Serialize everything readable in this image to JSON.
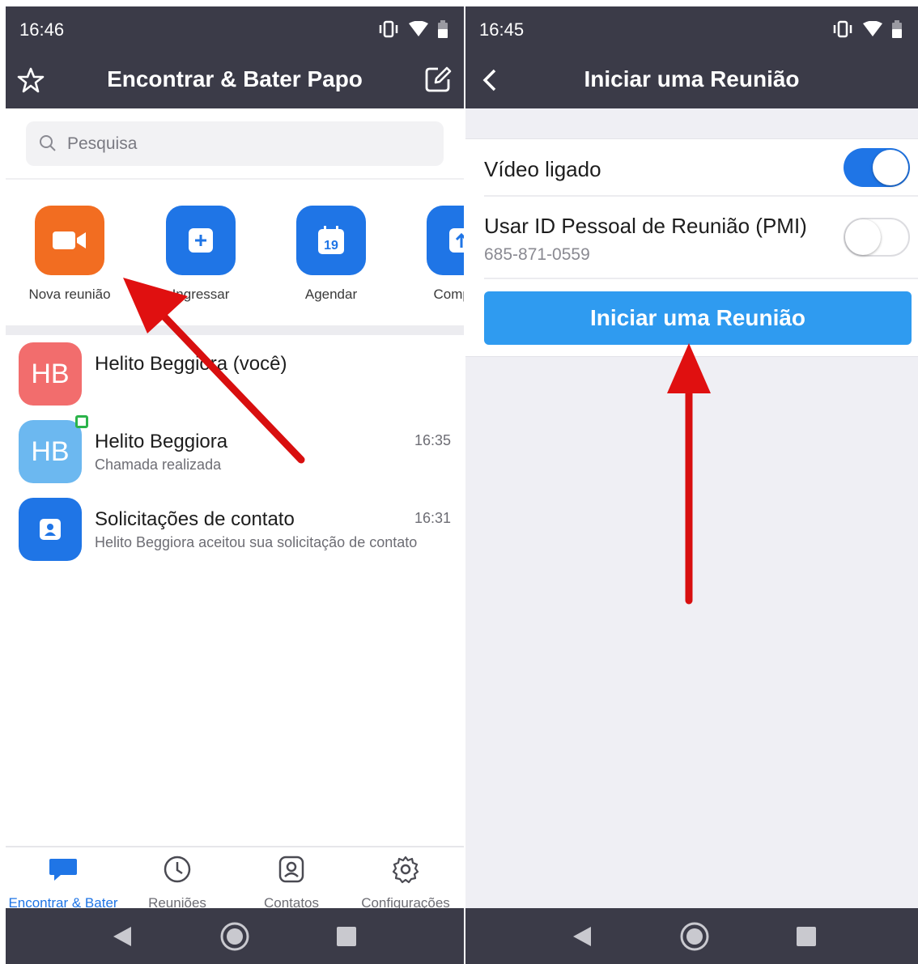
{
  "left": {
    "status": {
      "time": "16:46"
    },
    "header": {
      "title": "Encontrar & Bater Papo",
      "star_icon": "star-icon",
      "compose_icon": "compose-icon"
    },
    "search": {
      "placeholder": "Pesquisa"
    },
    "actions": [
      {
        "label": "Nova reunião",
        "icon": "video-camera-icon",
        "color": "#f26d21"
      },
      {
        "label": "Ingressar",
        "icon": "plus-icon",
        "color": "#1f75e6"
      },
      {
        "label": "Agendar",
        "icon": "calendar-icon",
        "day": "19",
        "color": "#1f75e6"
      },
      {
        "label": "Comparti",
        "icon": "share-screen-icon",
        "color": "#1f75e6"
      }
    ],
    "chats": [
      {
        "initials": "HB",
        "name": "Helito Beggiora (você)",
        "subtitle": "",
        "time": "",
        "color": "#f26d6d"
      },
      {
        "initials": "HB",
        "name": "Helito Beggiora",
        "subtitle": "Chamada realizada",
        "time": "16:35",
        "color": "#6cb8f0"
      },
      {
        "initials": "",
        "name": "Solicitações de contato",
        "subtitle": "Helito Beggiora aceitou sua solicitação de contato",
        "time": "16:31",
        "color": "#1f75e6"
      }
    ],
    "tabs": [
      {
        "label": "Encontrar & Bater",
        "icon": "chat-bubble-icon",
        "active": true
      },
      {
        "label": "Reuniões",
        "icon": "clock-icon",
        "active": false
      },
      {
        "label": "Contatos",
        "icon": "contact-icon",
        "active": false
      },
      {
        "label": "Configurações",
        "icon": "gear-icon",
        "active": false
      }
    ]
  },
  "right": {
    "status": {
      "time": "16:45"
    },
    "header": {
      "title": "Iniciar uma Reunião",
      "back_icon": "back-chevron-icon"
    },
    "settings": {
      "video": {
        "label": "Vídeo ligado",
        "enabled": true
      },
      "pmi": {
        "label": "Usar ID Pessoal de Reunião (PMI)",
        "value": "685-871-0559",
        "enabled": false
      }
    },
    "start_button": "Iniciar uma Reunião"
  },
  "colors": {
    "bar": "#3b3b48",
    "accent": "#1f75e6",
    "start_button": "#2f9bf0",
    "arrow": "#e01010"
  }
}
